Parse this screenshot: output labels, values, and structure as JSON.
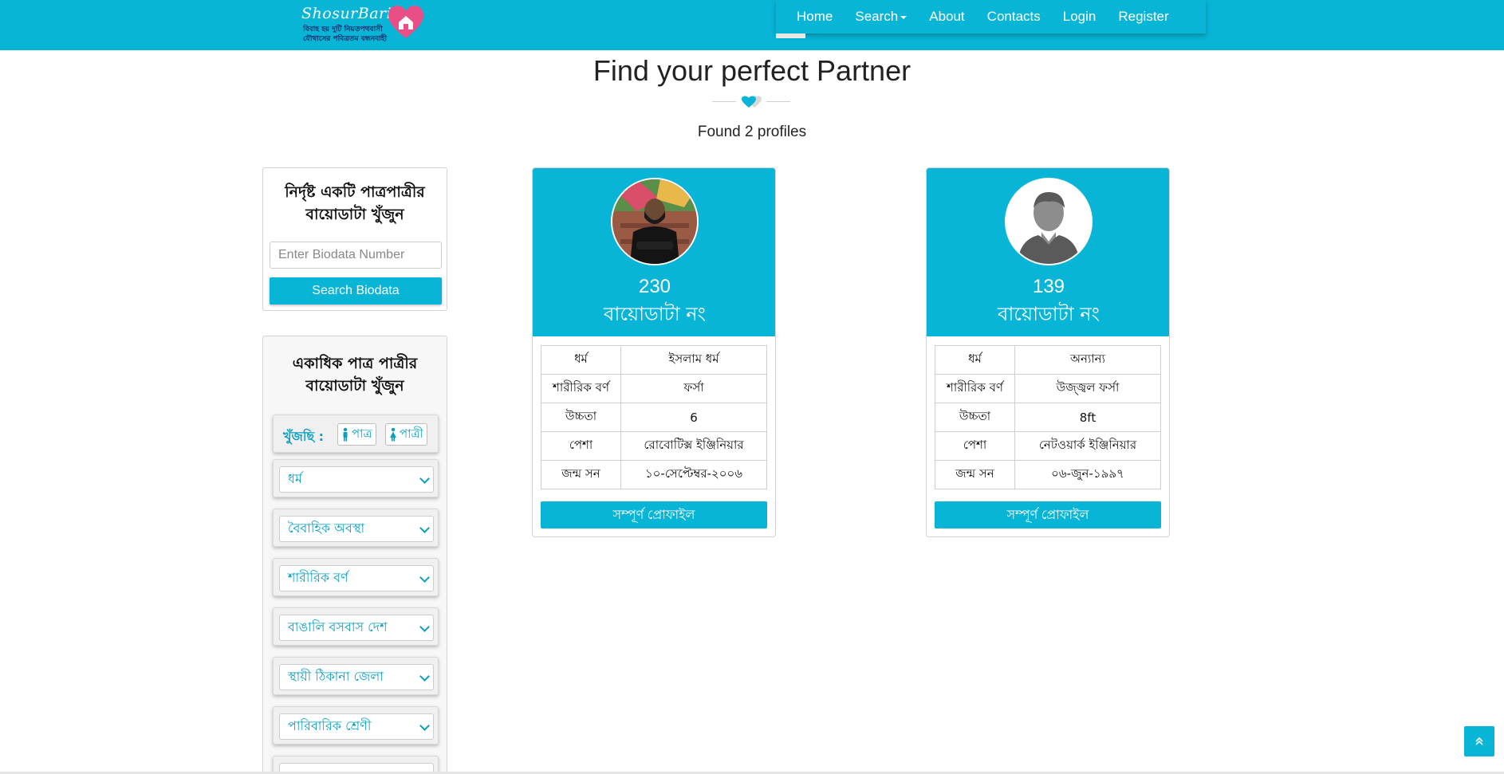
{
  "header": {
    "logo_title": "ShosurBari",
    "logo_line1": "বিবাহ হয় দুটি নিয়তপথবাসী",
    "logo_line2": "যৌথাসের পবিত্রতম বন্ধনবাহী",
    "nav": [
      "Home",
      "Search",
      "About",
      "Contacts",
      "Login",
      "Register"
    ]
  },
  "main": {
    "title": "Find your perfect Partner",
    "found": "Found 2 profiles"
  },
  "sidebar": {
    "single": {
      "heading_line1": "নির্দৃষ্ট একটি পাত্রপাত্রীর",
      "heading_line2": "বায়োডাটা খুঁজুন",
      "input_placeholder": "Enter Biodata Number",
      "button": "Search Biodata"
    },
    "multi": {
      "heading_line1": "একাধিক পাত্র পাত্রীর",
      "heading_line2": "বায়োডাটা খুঁজুন",
      "seek_label": "খুঁজছি :",
      "groom": "পাত্র",
      "bride": "পাত্রী",
      "filters": [
        "ধর্ম",
        "বৈবাহিক অবস্থা",
        "শারীরিক বর্ণ",
        "বাঙালি বসবাস দেশ",
        "স্থায়ী ঠিকানা জেলা",
        "পারিবারিক শ্রেণী"
      ]
    }
  },
  "profiles": [
    {
      "number": "230",
      "number_label": "বায়োডাটা নং",
      "rows": [
        {
          "k": "ধর্ম",
          "v": "ইসলাম ধর্ম"
        },
        {
          "k": "শারীরিক বর্ণ",
          "v": "ফর্সা"
        },
        {
          "k": "উচ্চতা",
          "v": "6"
        },
        {
          "k": "পেশা",
          "v": "রোবোটিক্স ইঞ্জিনিয়ার"
        },
        {
          "k": "জন্ম সন",
          "v": "১০-সেপ্টেম্বর-২০০৬"
        }
      ],
      "button": "সম্পূর্ণ প্রোফাইল"
    },
    {
      "number": "139",
      "number_label": "বায়োডাটা নং",
      "rows": [
        {
          "k": "ধর্ম",
          "v": "অন্যান্য"
        },
        {
          "k": "শারীরিক বর্ণ",
          "v": "উজ্জ্বল ফর্সা"
        },
        {
          "k": "উচ্চতা",
          "v": "8ft"
        },
        {
          "k": "পেশা",
          "v": "নেটওয়ার্ক ইঞ্জিনিয়ার"
        },
        {
          "k": "জন্ম সন",
          "v": "০৬-জুন-১৯৯৭"
        }
      ],
      "button": "সম্পূর্ণ প্রোফাইল"
    }
  ],
  "colors": {
    "brand": "#08b5d6",
    "accent_text": "#0a9ec1",
    "heart": "#e94f86"
  }
}
